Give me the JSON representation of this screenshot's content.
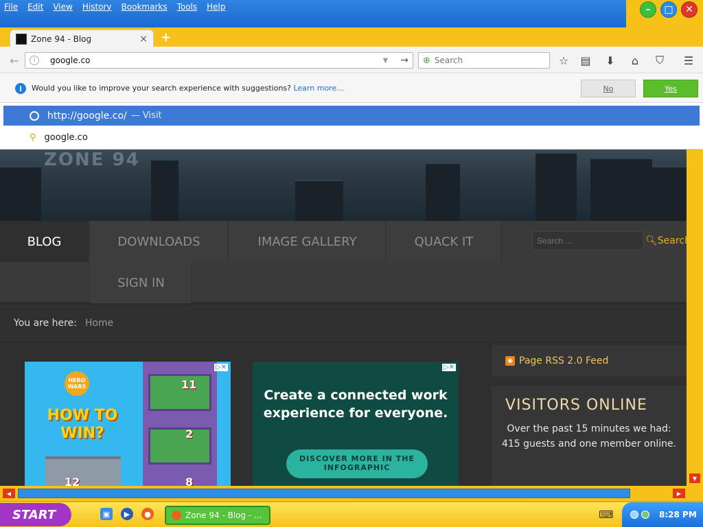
{
  "window": {
    "menu": [
      "File",
      "Edit",
      "View",
      "History",
      "Bookmarks",
      "Tools",
      "Help"
    ]
  },
  "tab": {
    "title": "Zone 94 - Blog",
    "close": "×",
    "new_tab": "+"
  },
  "navbar": {
    "url_value": "google.co",
    "search_placeholder": "Search"
  },
  "suggest": {
    "question": "Would you like to improve your search experience with suggestions?",
    "learn_more": "Learn more…",
    "no": "No",
    "yes": "Yes"
  },
  "autocomplete": {
    "visit_url": "http://google.co/",
    "visit_label": "— Visit",
    "search_term": "google.co"
  },
  "site": {
    "logo": "ZONE 94",
    "nav": [
      "BLOG",
      "DOWNLOADS",
      "IMAGE GALLERY",
      "QUACK IT",
      "SIGN IN"
    ],
    "search_placeholder": "Search ...",
    "search_button": "Search",
    "breadcrumb_label": "You are here:",
    "breadcrumb_home": "Home",
    "ad1": {
      "badge": "HERO WARS",
      "headline": "HOW TO WIN?",
      "numbers": [
        "11",
        "2",
        "12",
        "8"
      ]
    },
    "ad2": {
      "headline": "Create a connected work experience for everyone.",
      "cta": "DISCOVER MORE IN THE INFOGRAPHIC"
    },
    "rss": "Page RSS 2.0 Feed",
    "visitors_title": "VISITORS ONLINE",
    "visitors_text": "Over the past 15 minutes we had: 415 guests and one member online."
  },
  "taskbar": {
    "start": "START",
    "task": "Zone 94 - Blog - ...",
    "clock": "8:28 PM"
  },
  "colors": {
    "titlebar": "#1a6ad4",
    "accent_yellow": "#f6c21a",
    "yes_green": "#5bbd2b",
    "highlight": "#3c7ad6"
  }
}
